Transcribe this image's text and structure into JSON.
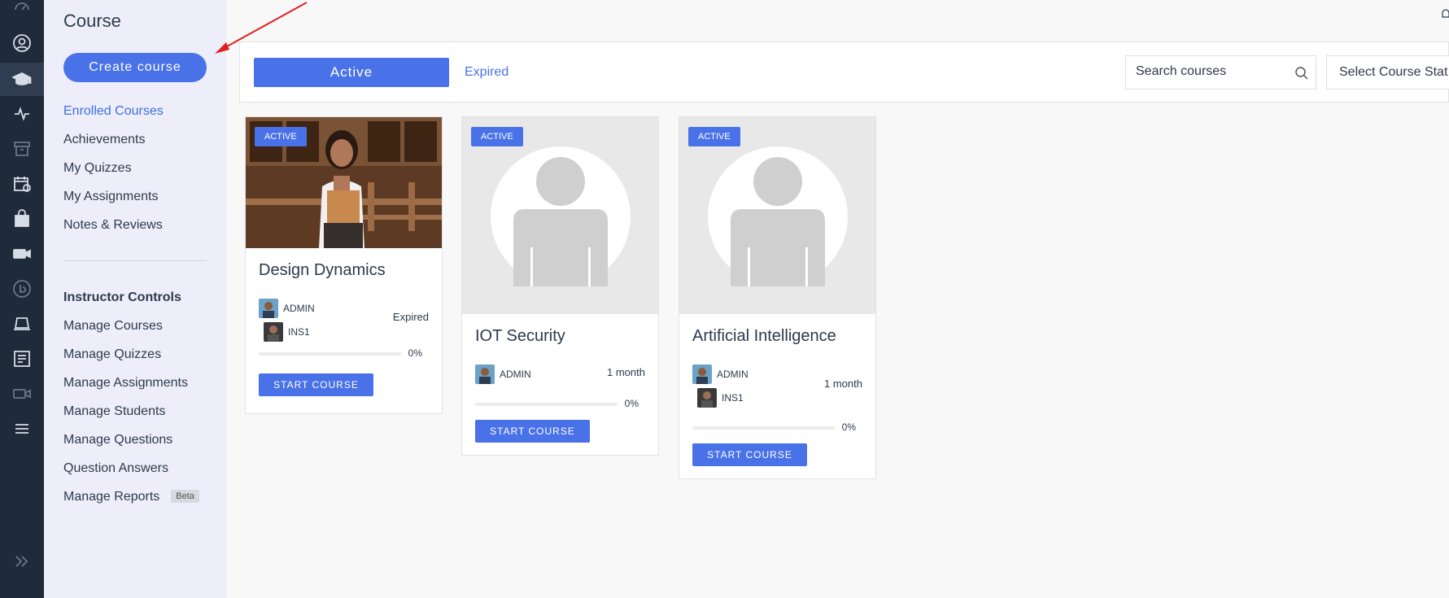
{
  "rail": {
    "icons": [
      "dashboard-icon",
      "profile-icon",
      "graduation-cap-icon",
      "activity-icon",
      "archive-icon",
      "calendar-clock-icon",
      "shopping-bag-icon",
      "video-camera-icon",
      "brand-circle-icon",
      "laptop-icon",
      "document-list-icon",
      "video-outline-icon",
      "menu-icon",
      "expand-icon"
    ]
  },
  "sidebar": {
    "title": "Course",
    "create_button": "Create course",
    "student_items": [
      "Enrolled Courses",
      "Achievements",
      "My Quizzes",
      "My Assignments",
      "Notes & Reviews"
    ],
    "instructor_heading": "Instructor Controls",
    "instructor_items": [
      "Manage Courses",
      "Manage Quizzes",
      "Manage Assignments",
      "Manage Students",
      "Manage Questions",
      "Question Answers",
      "Manage Reports"
    ],
    "beta_label": "Beta"
  },
  "topbar": {
    "tab_active": "Active",
    "tab_expired": "Expired",
    "search_placeholder": "Search courses",
    "select_label": "Select Course Stat"
  },
  "courses": [
    {
      "badge": "ACTIVE",
      "title": "Design Dynamics",
      "authors": [
        "ADMIN",
        "INS1"
      ],
      "meta": "Expired",
      "progress": "0%",
      "progress_value": 0,
      "button": "START COURSE"
    },
    {
      "badge": "ACTIVE",
      "title": "IOT Security",
      "authors": [
        "ADMIN"
      ],
      "meta": "1 month",
      "progress": "0%",
      "progress_value": 0,
      "button": "START COURSE"
    },
    {
      "badge": "ACTIVE",
      "title": "Artificial Intelligence",
      "authors": [
        "ADMIN",
        "INS1"
      ],
      "meta": "1 month",
      "progress": "0%",
      "progress_value": 0,
      "button": "START COURSE"
    }
  ],
  "colors": {
    "accent": "#4a72e8",
    "rail": "#1f2a3a",
    "sidebar": "#eeeefb",
    "annotation": "#e02020"
  }
}
